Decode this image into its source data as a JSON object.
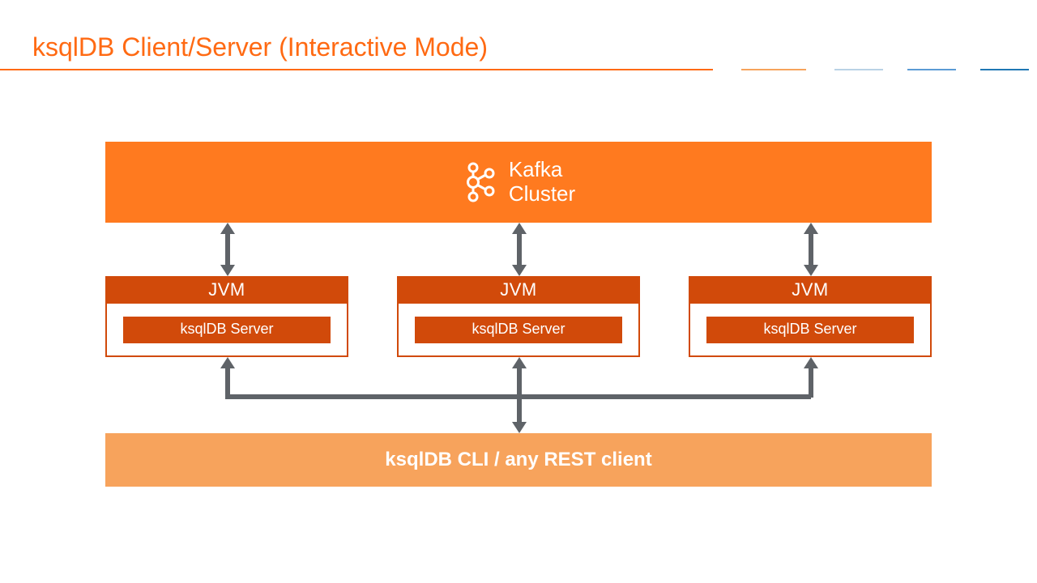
{
  "title": "ksqlDB Client/Server (Interactive Mode)",
  "kafka": {
    "line1": "Kafka",
    "line2": "Cluster"
  },
  "jvms": [
    {
      "head": "JVM",
      "server": "ksqlDB Server"
    },
    {
      "head": "JVM",
      "server": "ksqlDB Server"
    },
    {
      "head": "JVM",
      "server": "ksqlDB Server"
    }
  ],
  "client": "ksqlDB CLI / any REST client",
  "colors": {
    "accent": "#ff6a13",
    "accent_dark": "#d14a0a",
    "accent_light": "#f7a35c",
    "arrow": "#5f6368"
  }
}
